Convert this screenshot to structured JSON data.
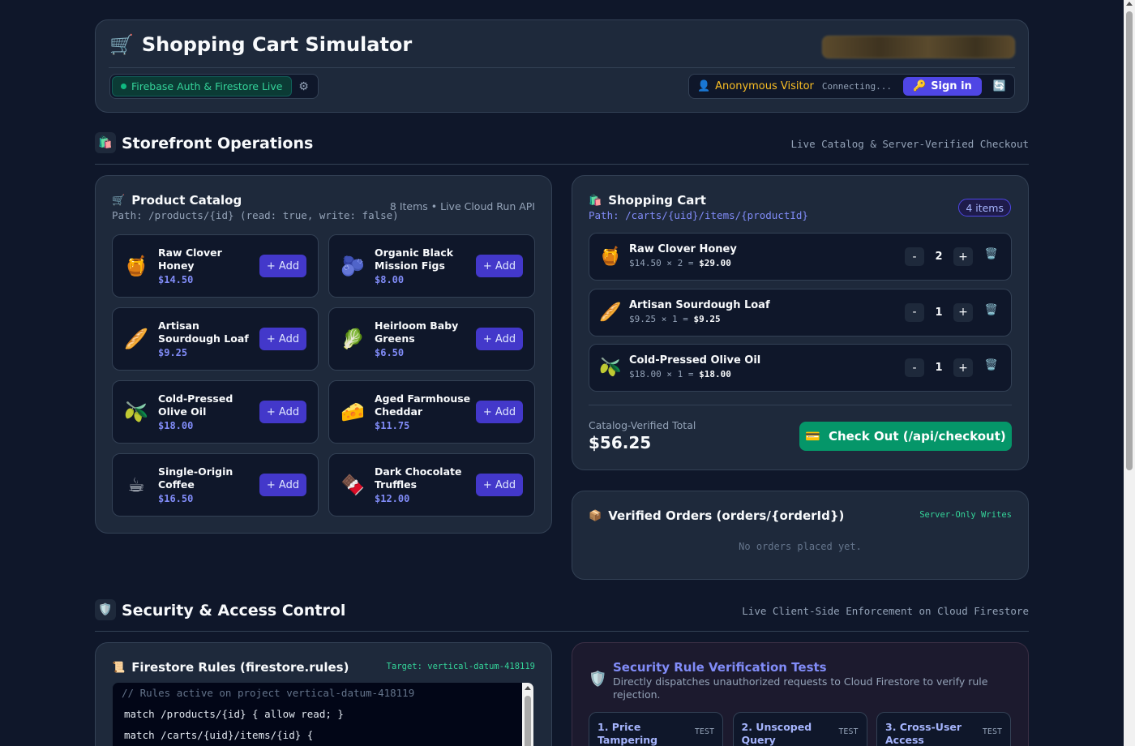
{
  "header": {
    "title": "Shopping Cart Simulator",
    "status": "Firebase Auth & Firestore Live",
    "user_name": "Anonymous Visitor",
    "connection": "Connecting...",
    "signin_label": "Sign in"
  },
  "storefront": {
    "title": "Storefront Operations",
    "subtitle": "Live Catalog & Server-Verified Checkout"
  },
  "catalog": {
    "title": "Product Catalog",
    "path": "Path: /products/{id} (read: true, write: false)",
    "meta": "8 Items • Live Cloud Run API",
    "add_label": "+ Add",
    "products": [
      {
        "emoji": "🍯",
        "name": "Raw Clover Honey",
        "price": "$14.50"
      },
      {
        "emoji": "🫐",
        "name": "Organic Black Mission Figs",
        "price": "$8.00"
      },
      {
        "emoji": "🥖",
        "name": "Artisan Sourdough Loaf",
        "price": "$9.25"
      },
      {
        "emoji": "🥬",
        "name": "Heirloom Baby Greens",
        "price": "$6.50"
      },
      {
        "emoji": "🫒",
        "name": "Cold-Pressed Olive Oil",
        "price": "$18.00"
      },
      {
        "emoji": "🧀",
        "name": "Aged Farmhouse Cheddar",
        "price": "$11.75"
      },
      {
        "emoji": "☕",
        "name": "Single-Origin Coffee",
        "price": "$16.50"
      },
      {
        "emoji": "🍫",
        "name": "Dark Chocolate Truffles",
        "price": "$12.00"
      }
    ]
  },
  "cart": {
    "title": "Shopping Cart",
    "path": "Path: /carts/{uid}/items/{productId}",
    "badge": "4 items",
    "items": [
      {
        "emoji": "🍯",
        "name": "Raw Clover Honey",
        "calc": "$14.50 × 2 = ",
        "total": "$29.00",
        "qty": "2"
      },
      {
        "emoji": "🥖",
        "name": "Artisan Sourdough Loaf",
        "calc": "$9.25 × 1 = ",
        "total": "$9.25",
        "qty": "1"
      },
      {
        "emoji": "🫒",
        "name": "Cold-Pressed Olive Oil",
        "calc": "$18.00 × 1 = ",
        "total": "$18.00",
        "qty": "1"
      }
    ],
    "minus": "-",
    "plus": "+",
    "total_label": "Catalog-Verified Total",
    "total_value": "$56.25",
    "checkout_label": "Check Out (/api/checkout)"
  },
  "orders": {
    "title": "Verified Orders (orders/{orderId})",
    "tag": "Server-Only Writes",
    "empty": "No orders placed yet."
  },
  "security": {
    "title": "Security & Access Control",
    "subtitle": "Live Client-Side Enforcement on Cloud Firestore"
  },
  "rules": {
    "title": "Firestore Rules (firestore.rules)",
    "target": "Target: vertical-datum-418119",
    "lines": [
      "// Rules active on project vertical-datum-418119",
      "match /products/{id} { allow read; }",
      "match /carts/{uid}/items/{id} {"
    ]
  },
  "tests": {
    "title": "Security Rule Verification Tests",
    "desc": "Directly dispatches unauthorized requests to Cloud Firestore to verify rule rejection.",
    "tag": "TEST",
    "items": [
      {
        "name": "1. Price Tampering"
      },
      {
        "name": "2. Unscoped Query"
      },
      {
        "name": "3. Cross-User Access"
      }
    ]
  },
  "colors": {
    "background": "#0f172a",
    "card": "#1e293b",
    "accent": "#4f46e5",
    "success": "#059669",
    "price": "#818cf8"
  }
}
